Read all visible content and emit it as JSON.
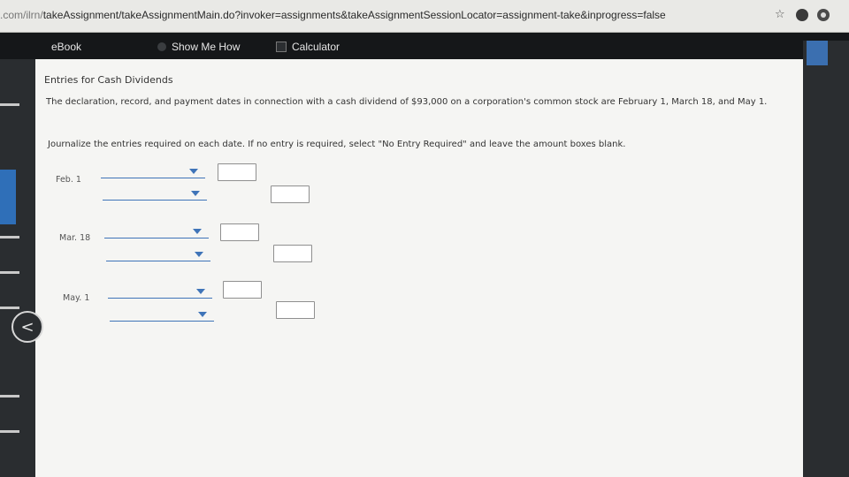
{
  "browser": {
    "url_prefix": ".com/ilrn/",
    "url_rest": "takeAssignment/takeAssignmentMain.do?invoker=assignments&takeAssignmentSessionLocator=assignment-take&inprogress=false",
    "star": "☆"
  },
  "toolbar": {
    "ebook": "eBook",
    "show_me_how": "Show Me How",
    "calculator": "Calculator"
  },
  "page": {
    "heading": "Entries for Cash Dividends",
    "paragraph": "The declaration, record, and payment dates in connection with a cash dividend of $93,000 on a corporation's common stock are February 1, March 18, and May 1.",
    "instruction": "Journalize the entries required on each date. If no entry is required, select \"No Entry Required\" and leave the amount boxes blank."
  },
  "entries": [
    {
      "date": "Feb. 1"
    },
    {
      "date": "Mar. 18"
    },
    {
      "date": "May. 1"
    }
  ],
  "nav": {
    "back_glyph": "<"
  },
  "colors": {
    "accent": "#3f74b8",
    "toolbar_bg": "#151719",
    "content_bg": "#f5f5f3"
  }
}
